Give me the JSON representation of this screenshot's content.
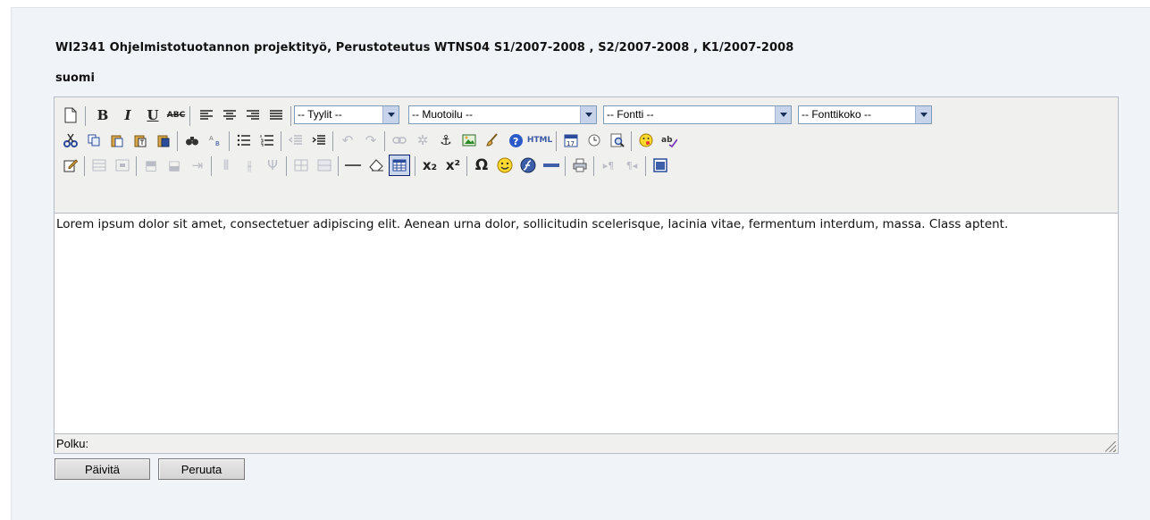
{
  "course_title": "WI2341 Ohjelmistotuotannon projektityö, Perustoteutus  WTNS04 S1/2007-2008 , S2/2007-2008 , K1/2007-2008",
  "language": "suomi",
  "selects": {
    "styles": "-- Tyylit --",
    "format": "-- Muotoilu --",
    "font": "-- Fontti --",
    "fontsize": "-- Fonttikoko --"
  },
  "icons": {
    "bold": "B",
    "italic": "I",
    "underline": "U",
    "strike": "ABC",
    "html": "HTML",
    "subscript": "x₂",
    "superscript": "x²",
    "omega": "Ω"
  },
  "content_text": "Lorem ipsum dolor sit amet, consectetuer adipiscing elit. Aenean urna dolor, sollicitudin scelerisque, lacinia vitae, fermentum interdum, massa. Class aptent.",
  "status_path_label": "Polku:",
  "buttons": {
    "update": "Päivitä",
    "cancel": "Peruuta"
  }
}
